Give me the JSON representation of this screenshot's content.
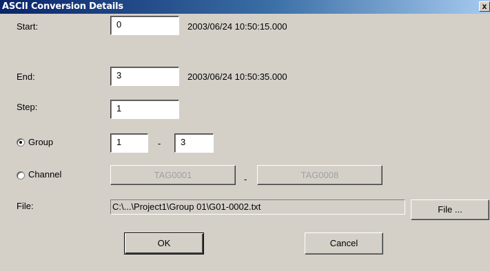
{
  "window": {
    "title": "ASCII Conversion Details",
    "close_glyph": "x"
  },
  "start": {
    "label": "Start:",
    "value": "0",
    "timestamp": "2003/06/24 10:50:15.000"
  },
  "end": {
    "label": "End:",
    "value": "3",
    "timestamp": "2003/06/24 10:50:35.000"
  },
  "step": {
    "label": "Step:",
    "value": "1"
  },
  "group": {
    "label": "Group",
    "selected": true,
    "from": "1",
    "separator": "-",
    "to": "3"
  },
  "channel": {
    "label": "Channel",
    "selected": false,
    "from": "TAG0001",
    "separator": "-",
    "to": "TAG0008"
  },
  "file": {
    "label": "File:",
    "path": "C:\\...\\Project1\\Group 01\\G01-0002.txt",
    "button_label": "File ..."
  },
  "buttons": {
    "ok": "OK",
    "cancel": "Cancel"
  }
}
